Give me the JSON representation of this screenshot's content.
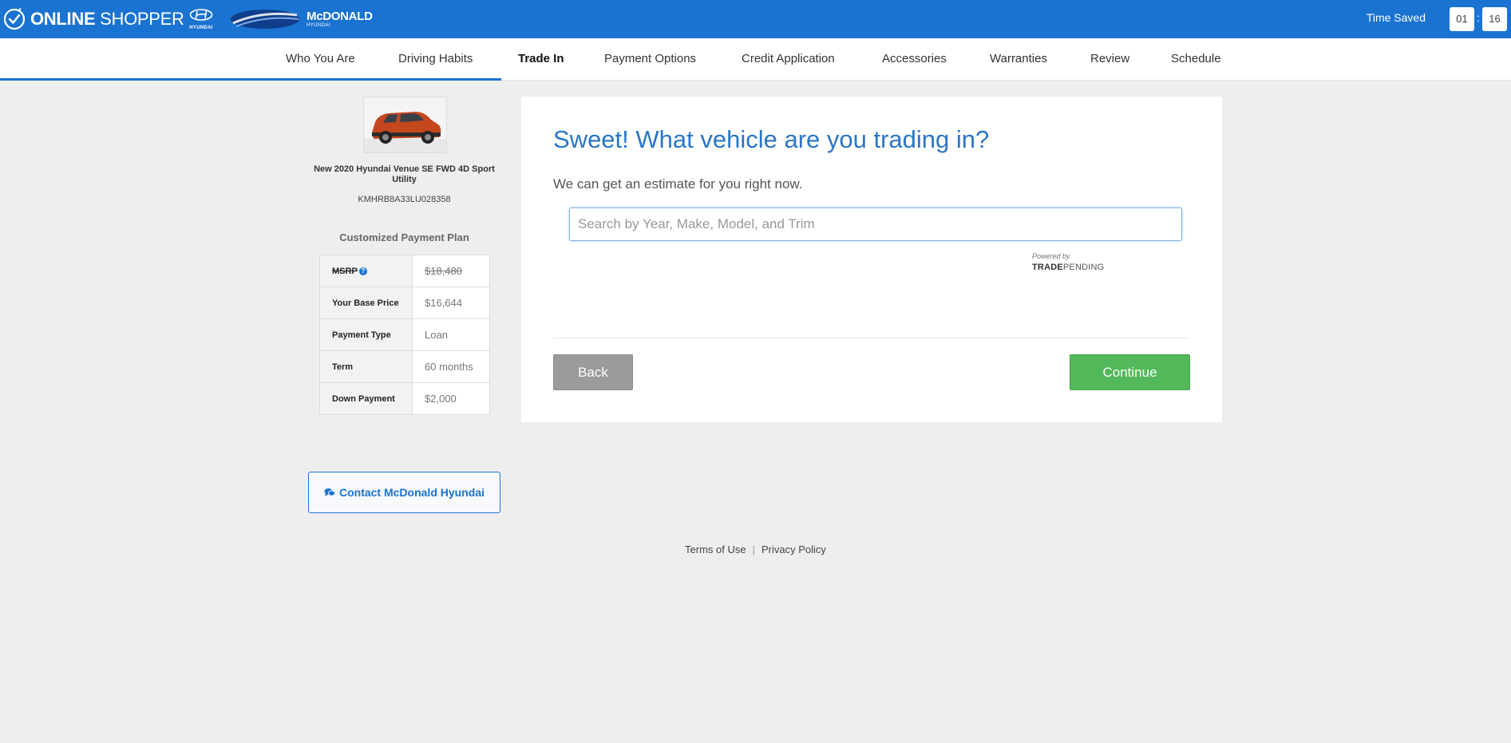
{
  "header": {
    "brand_bold": "ONLINE",
    "brand_rest": " SHOPPER",
    "oem_logo_text": "HYUNDAI",
    "dealer_name": "McDONALD",
    "dealer_sub": "HYUNDAI",
    "time_saved_label": "Time Saved",
    "time_minutes": "01",
    "time_separator": ":",
    "time_seconds": "16",
    "accent_color": "#1a73d1"
  },
  "nav": {
    "items": [
      {
        "label": "Who You Are"
      },
      {
        "label": "Driving Habits"
      },
      {
        "label": "Trade In"
      },
      {
        "label": "Payment Options"
      },
      {
        "label": "Credit Application"
      },
      {
        "label": "Accessories"
      },
      {
        "label": "Warranties"
      },
      {
        "label": "Review"
      },
      {
        "label": "Schedule"
      }
    ],
    "active_index": 2
  },
  "vehicle": {
    "title": "New 2020 Hyundai Venue SE FWD 4D Sport Utility",
    "vin": "KMHRB8A33LU028358",
    "color": "#c4471e"
  },
  "payment_plan": {
    "title": "Customized Payment Plan",
    "rows": [
      {
        "label": "MSRP",
        "value": "$18,480"
      },
      {
        "label": "Your Base Price",
        "value": "$16,644"
      },
      {
        "label": "Payment Type",
        "value": "Loan"
      },
      {
        "label": "Term",
        "value": "60 months"
      },
      {
        "label": "Down Payment",
        "value": "$2,000"
      }
    ],
    "help_icon": "?"
  },
  "contact": {
    "label": "Contact McDonald Hyundai",
    "icon": "chat-bubbles-icon"
  },
  "trade_in": {
    "title": "Sweet! What vehicle are you trading in?",
    "subtitle": "We can get an estimate for you right now.",
    "search_placeholder": "Search by Year, Make, Model, and Trim",
    "search_value": "",
    "powered_by": "Powered by",
    "provider_bold": "TRADE",
    "provider_rest": "PENDING",
    "back_label": "Back",
    "continue_label": "Continue",
    "continue_color": "#53b85a"
  },
  "footer": {
    "terms": "Terms of Use",
    "separator": "|",
    "privacy": "Privacy Policy"
  }
}
